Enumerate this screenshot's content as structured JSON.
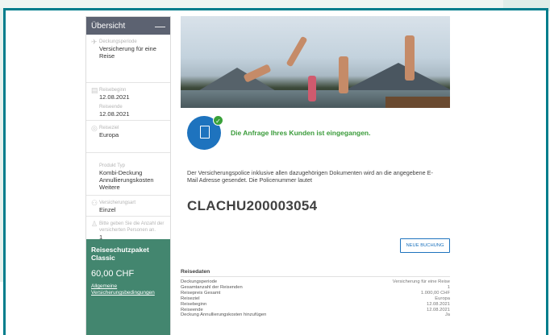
{
  "sidebar": {
    "header": "Übersicht",
    "collapse_symbol": "—",
    "sections": [
      {
        "icon": "airplane-icon",
        "label": "Deckungsperiode",
        "value": "Versicherung für eine Reise"
      },
      {
        "icon": "calendar-icon",
        "label": "Reisebeginn",
        "value": "12.08.2021",
        "label2": "Reiseende",
        "value2": "12.08.2021"
      },
      {
        "icon": "globe-icon",
        "label": "Reiseziel",
        "value": "Europa"
      },
      {
        "icon": "",
        "label": "Produkt Typ",
        "value": "Kombi-Deckung Annullierungskosten Weitere"
      },
      {
        "icon": "people-icon",
        "label": "Versicherungsart",
        "value": "Einzel"
      },
      {
        "icon": "person-icon",
        "label": "Bitte geben Sie die Anzahl der versicherten Personen an.",
        "value": "1"
      }
    ],
    "package": {
      "title": "Reiseschutzpaket Classic",
      "price": "60,00 CHF",
      "link": "Allgemeine Versicherungsbedingungen"
    }
  },
  "main": {
    "success_message": "Die Anfrage Ihres Kunden ist eingegangen.",
    "description": "Der Versicherungspolice inklusive allen dazugehörigen Dokumenten wird an die angegebene E-Mail Adresse gesendet. Die Policenummer lautet",
    "policy_number": "CLACHU200003054",
    "new_booking_label": "NEUE BUCHUNG",
    "reisedaten": {
      "title": "Reisedaten",
      "rows": [
        {
          "label": "Deckungsperiode",
          "value": "Versicherung für eine Reise"
        },
        {
          "label": "Gesamtanzahl der Reisenden",
          "value": "1"
        },
        {
          "label": "Reisepreis Gesamt",
          "value": "1.000,00 CHF"
        },
        {
          "label": "Reiseziel",
          "value": "Europa"
        },
        {
          "label": "Reisebeginn",
          "value": "12.08.2021"
        },
        {
          "label": "Reiseende",
          "value": "12.08.2021"
        },
        {
          "label": "Deckung Annullierungskosten hinzufügen",
          "value": "Ja"
        }
      ]
    }
  },
  "colors": {
    "accent": "#007d8c",
    "sidebar_header": "#5c6271",
    "package": "#43866f",
    "primary_blue": "#1e73be",
    "success": "#3a9b3a"
  }
}
